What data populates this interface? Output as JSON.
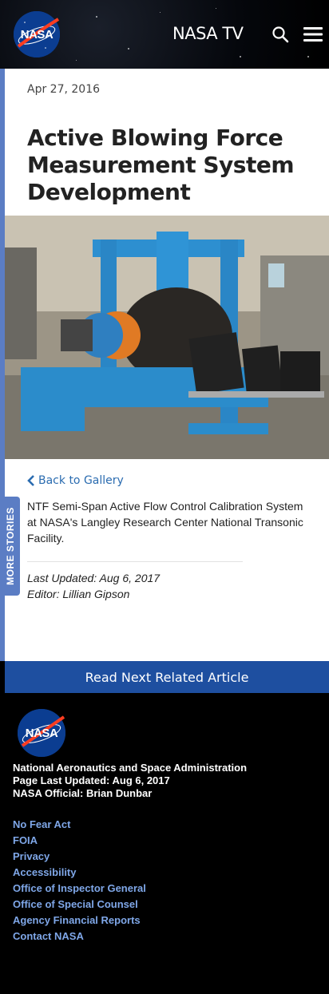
{
  "header": {
    "logo_text": "NASA",
    "nav_title": "NASA TV",
    "icons": [
      "search-icon",
      "menu-icon"
    ]
  },
  "article": {
    "date": "Apr 27, 2016",
    "title": "Active Blowing Force Measurement System Development",
    "back_label": "Back to Gallery",
    "caption": "NTF Semi-Span Active Flow Control Calibration System at NASA's Langley Research Center National Transonic Facility.",
    "last_updated": "Last Updated: Aug 6, 2017",
    "editor": "Editor: Lillian Gipson"
  },
  "side_tab": {
    "label": "MORE STORIES"
  },
  "read_next": {
    "label": "Read Next Related Article"
  },
  "footer": {
    "logo_text": "NASA",
    "agency_name": "National Aeronautics and Space Administration",
    "page_updated": "Page Last Updated: Aug 6, 2017",
    "official": "NASA Official: Brian Dunbar",
    "links": [
      "No Fear Act",
      "FOIA",
      "Privacy",
      "Accessibility",
      "Office of Inspector General",
      "Office of Special Counsel",
      "Agency Financial Reports",
      "Contact NASA"
    ]
  },
  "colors": {
    "accent": "#1e4fa0",
    "side_tab": "#5b7dc4",
    "link": "#2b6cb0",
    "footer_link": "#7fa7e8",
    "nasa_blue": "#0b3d91",
    "nasa_red": "#fc3d21"
  }
}
